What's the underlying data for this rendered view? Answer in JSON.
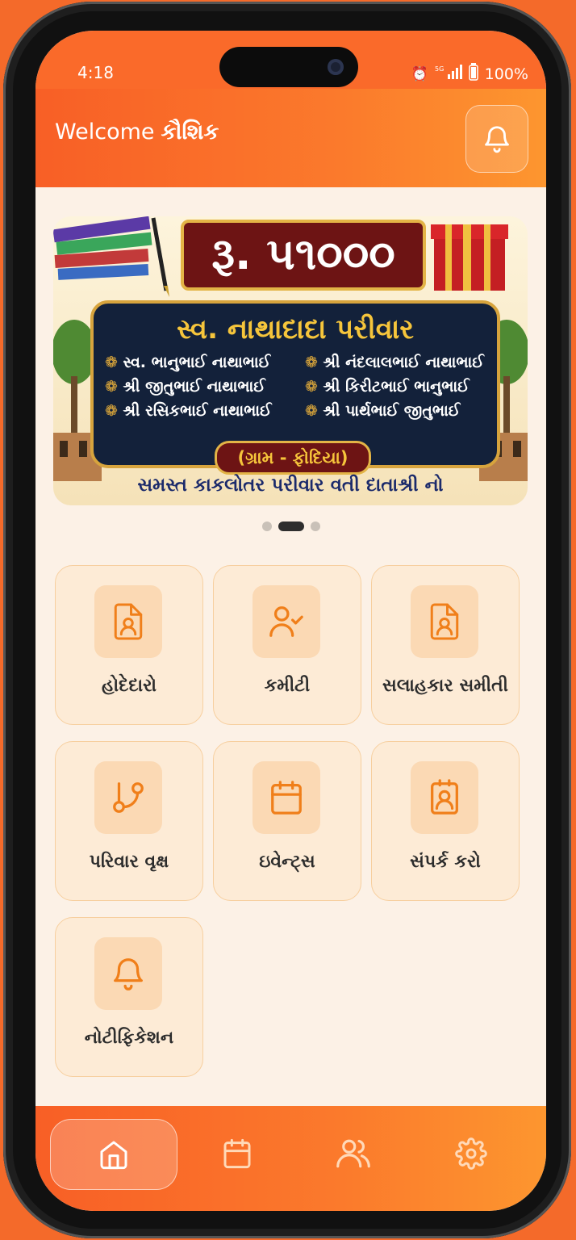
{
  "status_bar": {
    "time": "4:18",
    "network": "5G",
    "battery": "100%"
  },
  "header": {
    "welcome_text": "Welcome",
    "user_name": "કૌશિક",
    "bell_icon": "bell-icon"
  },
  "banner": {
    "amount": "રૂ. ૫૧૦૦૦",
    "family_title": "સ્વ. નાથાદાદા પરીવાર",
    "names": [
      "સ્વ. ભાનુભાઈ નાથાભાઈ",
      "શ્રી નંદલાલભાઈ નાથાભાઈ",
      "શ્રી જીતુભાઈ નાથાભાઈ",
      "શ્રી કિરીટભાઈ ભાનુભાઈ",
      "શ્રી રસિકભાઈ નાથાભાઈ",
      "શ્રી પાર્થભાઈ જીતુભાઈ"
    ],
    "village": "(ગ્રામ - ફોદિયા)",
    "footer": "સમસ્ત કાકલોતર પરીવાર વતી દાતાશ્રી નો",
    "slides_total": 3,
    "active_slide": 2
  },
  "menu": [
    {
      "label": "હોદેદારો",
      "icon": "person-document-icon"
    },
    {
      "label": "કમીટી",
      "icon": "user-check-icon"
    },
    {
      "label": "સલાહકાર સમીતી",
      "icon": "person-document-icon"
    },
    {
      "label": "પરિવાર વૃક્ષ",
      "icon": "git-branch-icon"
    },
    {
      "label": "ઇવેન્ટ્સ",
      "icon": "calendar-icon"
    },
    {
      "label": "સંપર્ક કરો",
      "icon": "contact-card-icon"
    },
    {
      "label": "નોટીફિકેશન",
      "icon": "bell-icon"
    }
  ],
  "bottom_nav": [
    {
      "name": "home",
      "icon": "home-icon",
      "active": true
    },
    {
      "name": "events",
      "icon": "calendar-icon",
      "active": false
    },
    {
      "name": "members",
      "icon": "users-icon",
      "active": false
    },
    {
      "name": "settings",
      "icon": "gear-icon",
      "active": false
    }
  ],
  "colors": {
    "primary": "#f85f26",
    "accent": "#fd962f",
    "tile_bg": "#fdebd6",
    "icon_stroke": "#f07f1a",
    "background": "#fcf1e6"
  }
}
